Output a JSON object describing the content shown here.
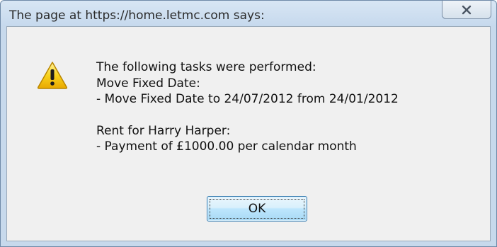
{
  "dialog": {
    "title": "The page at https://home.letmc.com says:",
    "close_icon": "close-icon",
    "warning_icon": "warning-icon",
    "message_lines": [
      "The following tasks were performed:",
      "Move Fixed Date:",
      "- Move Fixed Date to 24/07/2012 from 24/01/2012",
      "",
      "Rent for Harry Harper:",
      "- Payment of £1000.00 per calendar month"
    ],
    "ok_label": "OK"
  },
  "colors": {
    "frame": "#c7d9ec",
    "content_background": "#f0f0f0",
    "button_border": "#3c7fb1",
    "warning_yellow": "#f5c400"
  }
}
